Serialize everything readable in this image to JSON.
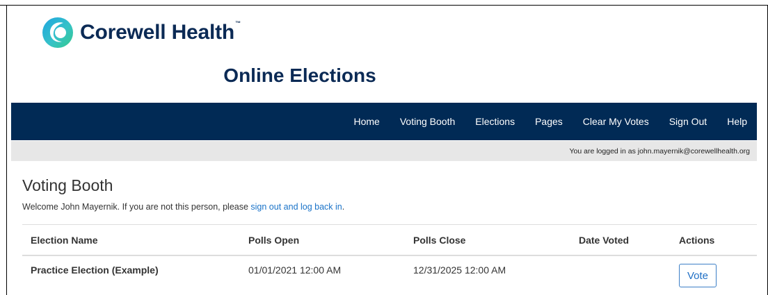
{
  "brand": {
    "name": "Corewell Health",
    "trademark": "™",
    "colors": {
      "navy": "#0b2a55",
      "teal": "#36c2c8",
      "cyan": "#1fa5e0",
      "green": "#34c98c"
    }
  },
  "app_title": "Online Elections",
  "nav": {
    "items": [
      "Home",
      "Voting Booth",
      "Elections",
      "Pages",
      "Clear My Votes",
      "Sign Out",
      "Help"
    ],
    "background": "#012a55"
  },
  "status": {
    "login_text": "You are logged in as john.mayernik@corewellhealth.org"
  },
  "page": {
    "heading": "Voting Booth",
    "welcome_prefix": "Welcome John Mayernik. If you are not this person, please ",
    "welcome_link": "sign out and log back in",
    "welcome_suffix": "."
  },
  "table": {
    "headers": [
      "Election Name",
      "Polls Open",
      "Polls Close",
      "Date Voted",
      "Actions"
    ],
    "rows": [
      {
        "election_name": "Practice Election (Example)",
        "polls_open": "01/01/2021 12:00 AM",
        "polls_close": "12/31/2025 12:00 AM",
        "date_voted": "",
        "action_label": "Vote"
      }
    ]
  }
}
